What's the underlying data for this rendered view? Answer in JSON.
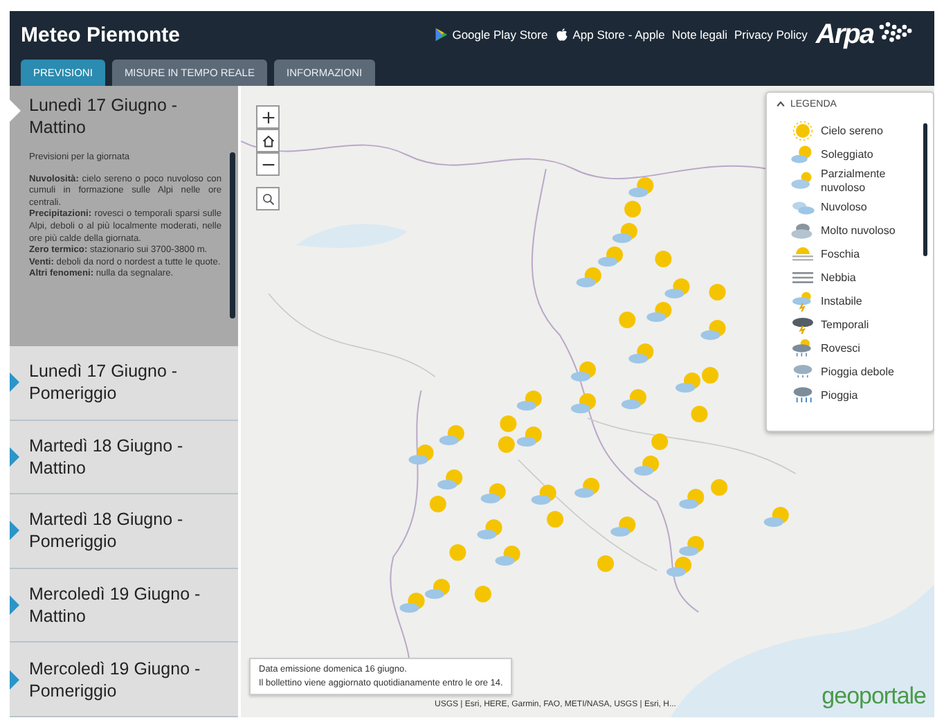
{
  "header": {
    "title": "Meteo Piemonte",
    "links": [
      {
        "label": "Google Play Store",
        "kind": "play"
      },
      {
        "label": "App Store - Apple",
        "kind": "apple"
      },
      {
        "label": "Note legali",
        "kind": "plain"
      },
      {
        "label": "Privacy Policy",
        "kind": "plain"
      }
    ],
    "logo": "Arpa"
  },
  "tabs": [
    {
      "label": "PREVISIONI",
      "selected": true
    },
    {
      "label": "MISURE IN TEMPO REALE",
      "selected": false
    },
    {
      "label": "INFORMAZIONI",
      "selected": false
    }
  ],
  "days": [
    {
      "title": "Lunedì 17 Giugno - Mattino",
      "selected": true
    },
    {
      "title": "Lunedì 17 Giugno - Pomeriggio",
      "selected": false
    },
    {
      "title": "Martedì 18 Giugno - Mattino",
      "selected": false
    },
    {
      "title": "Martedì 18 Giugno - Pomeriggio",
      "selected": false
    },
    {
      "title": "Mercoledì 19 Giugno - Mattino",
      "selected": false
    },
    {
      "title": "Mercoledì 19 Giugno - Pomeriggio",
      "selected": false
    }
  ],
  "forecast": {
    "heading": "Previsioni per la giornata",
    "paragraphs": [
      "**Nuvolosità:** cielo sereno o poco nuvoloso con cumuli in formazione sulle Alpi nelle ore centrali.",
      "**Precipitazioni:** rovesci o temporali sparsi sulle Alpi, deboli o al più localmente moderati, nelle ore più calde della giornata.",
      "**Zero termico:** stazionario sui 3700-3800 m.",
      "**Venti:** deboli da nord o nordest a tutte le quote.",
      "**Altri fenomeni:** nulla da segnalare."
    ]
  },
  "legend": {
    "title": "LEGENDA",
    "items": [
      {
        "label": "Cielo sereno",
        "kind": "sun"
      },
      {
        "label": "Soleggiato",
        "kind": "sunny"
      },
      {
        "label": "Parzialmente nuvoloso",
        "kind": "partly"
      },
      {
        "label": "Nuvoloso",
        "kind": "cloudy"
      },
      {
        "label": "Molto nuvoloso",
        "kind": "overcast"
      },
      {
        "label": "Foschia",
        "kind": "haze"
      },
      {
        "label": "Nebbia",
        "kind": "fog"
      },
      {
        "label": "Instabile",
        "kind": "unstable"
      },
      {
        "label": "Temporali",
        "kind": "storm"
      },
      {
        "label": "Rovesci",
        "kind": "showers"
      },
      {
        "label": "Pioggia debole",
        "kind": "lightrain"
      },
      {
        "label": "Pioggia",
        "kind": "rain"
      }
    ]
  },
  "info": [
    "Data emissione domenica 16 giugno.",
    "Il bollettino viene aggiornato quotidianamente entro le ore 14."
  ],
  "attribution": "USGS | Esri, HERE, Garmin, FAO, METI/NASA, USGS | Esri, H...",
  "map_logo": "geoportale"
}
